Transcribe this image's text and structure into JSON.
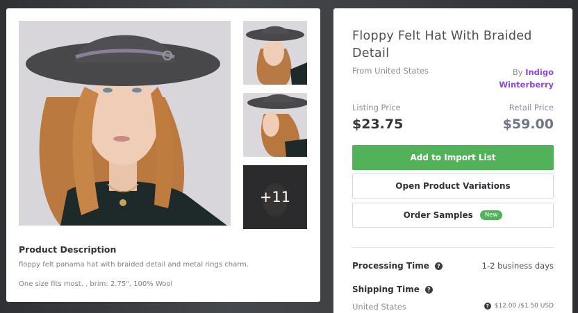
{
  "gallery": {
    "main_photo_alt": "product-photo-model-wearing-hat",
    "more_count": "+11"
  },
  "description": {
    "heading": "Product Description",
    "text": "floppy felt panama hat with braided detail and metal rings charm.",
    "specs": "One size fits most. , brim: 2.75\", 100% Wool"
  },
  "product": {
    "title": "Floppy Felt Hat With Braided Detail",
    "origin": "From United States",
    "by_prefix": "By",
    "seller": "Indigo Winterberry"
  },
  "pricing": {
    "listing_label": "Listing Price",
    "listing_value": "$23.75",
    "retail_label": "Retail Price",
    "retail_value": "$59.00"
  },
  "actions": {
    "add_to_import": "Add to Import List",
    "open_variations": "Open Product Variations",
    "order_samples": "Order Samples",
    "new_badge": "New"
  },
  "shipping": {
    "processing_label": "Processing Time",
    "processing_value": "1-2 business days",
    "shipping_label": "Shipping Time",
    "country": "United States",
    "cost": "$12.00 /$1.50 USD"
  },
  "icons": {
    "help": "help-circle-icon"
  },
  "colors": {
    "primary_green": "#52b25a",
    "seller_purple": "#8a47d8"
  }
}
